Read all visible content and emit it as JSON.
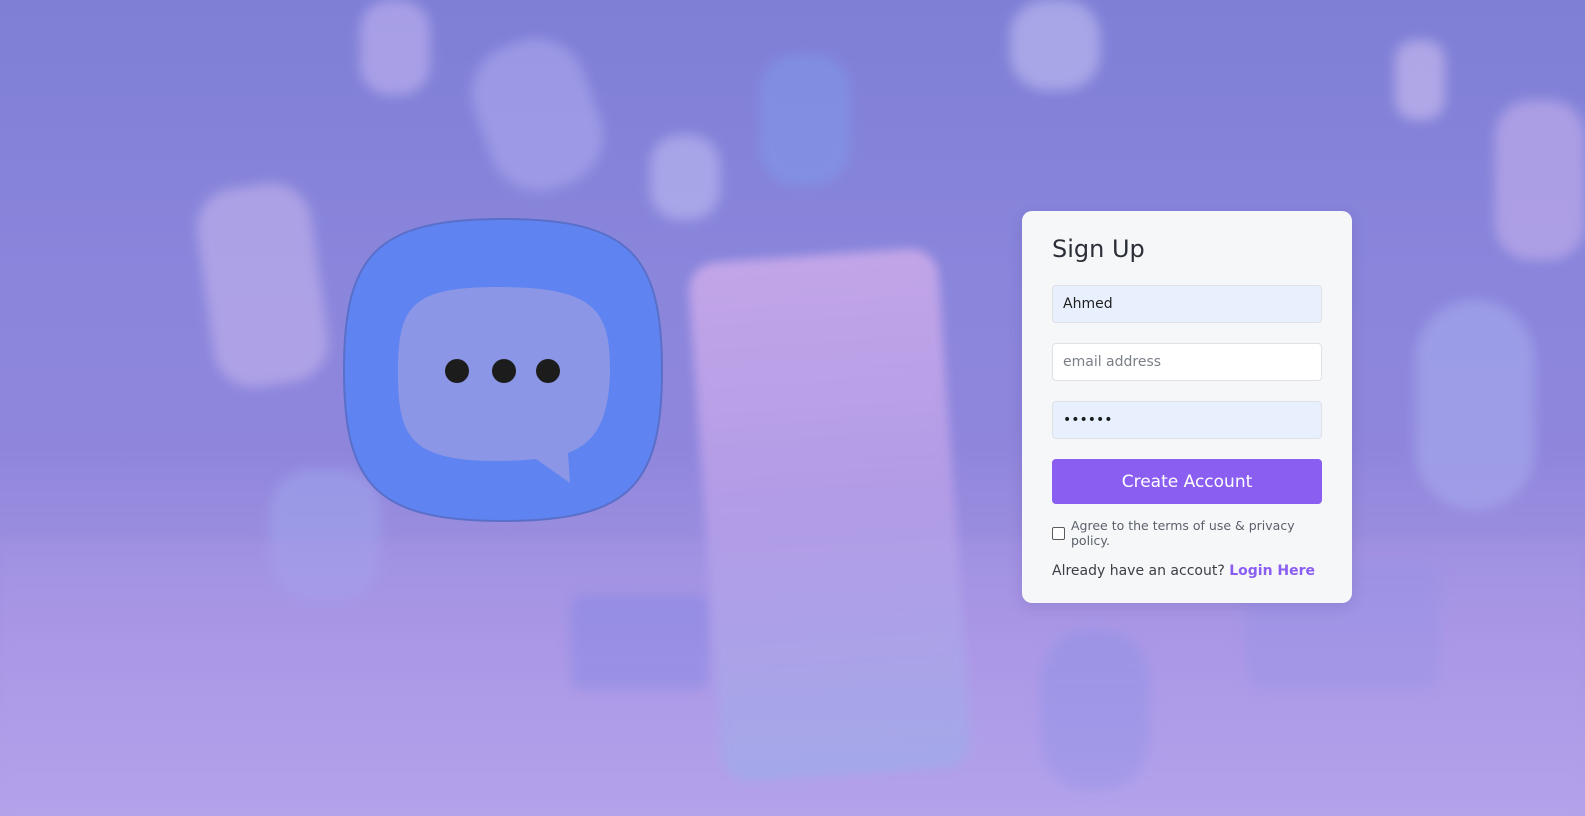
{
  "form": {
    "title": "Sign Up",
    "name_value": "Ahmed",
    "email_placeholder": "email address",
    "email_value": "",
    "password_value": "••••••",
    "submit_label": "Create Account",
    "terms_label": "Agree to the terms of use & privacy policy.",
    "terms_checked": false,
    "login_prompt": "Already have an accout?",
    "login_link": "Login Here"
  },
  "colors": {
    "accent": "#8a5ef0",
    "card_bg": "#f6f7f9",
    "logo_blue": "#5f84f1"
  },
  "icons": {
    "logo": "chat-bubble-icon"
  }
}
